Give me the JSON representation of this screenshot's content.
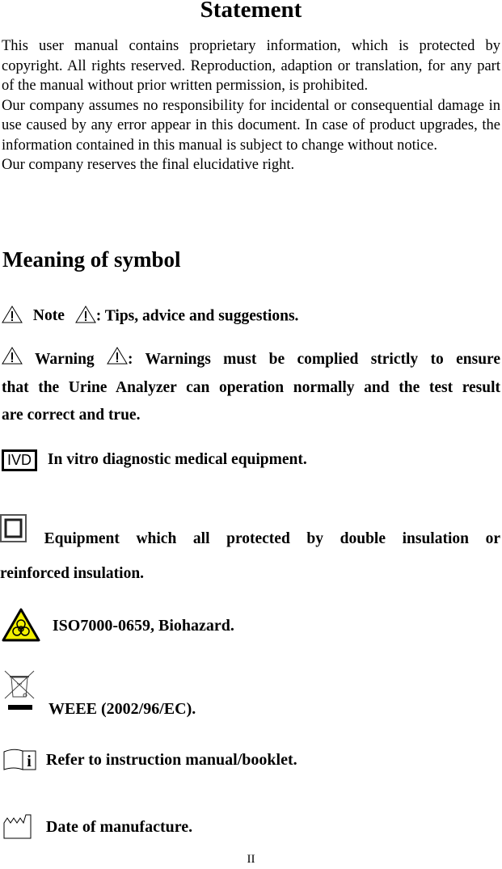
{
  "title": "Statement",
  "statement": {
    "p1": "This user manual contains proprietary information, which is protected by copyright. All rights reserved. Reproduction, adaption or translation, for any part of the manual without prior written permission, is prohibited.",
    "p2": "Our company assumes no responsibility for incidental or consequential damage in use caused by any error appear in this document. In case of product upgrades, the information contained in this manual is subject to change without notice.",
    "p3": "Our company reserves the final elucidative right."
  },
  "symbols_heading": "Meaning of symbol",
  "symbols": {
    "note": {
      "label": "Note",
      "desc": ": Tips, advice and suggestions.",
      "icon": "warning-triangle-icon"
    },
    "warning": {
      "label": "Warning",
      "desc": ": Warnings must be complied strictly to ensure",
      "desc2": "that the Urine Analyzer can operation normally and the test result",
      "desc3": "are correct and true.",
      "icon": "warning-triangle-icon"
    },
    "ivd": {
      "icon_text": "IVD",
      "desc": "In vitro diagnostic medical equipment.",
      "icon": "ivd-icon"
    },
    "double_insulation": {
      "desc": "Equipment which all protected by double insulation or",
      "desc2": "reinforced insulation.",
      "icon": "double-insulation-icon"
    },
    "biohazard": {
      "desc": "ISO7000-0659, Biohazard.",
      "icon": "biohazard-icon",
      "color": "#ffff00"
    },
    "weee": {
      "desc": "WEEE (2002/96/EC).",
      "icon": "weee-bin-icon"
    },
    "manual": {
      "desc": "Refer to instruction manual/booklet.",
      "icon": "instruction-manual-icon"
    },
    "manufacture": {
      "desc": "Date of manufacture.",
      "icon": "date-of-manufacture-icon"
    }
  },
  "page_number": "II"
}
